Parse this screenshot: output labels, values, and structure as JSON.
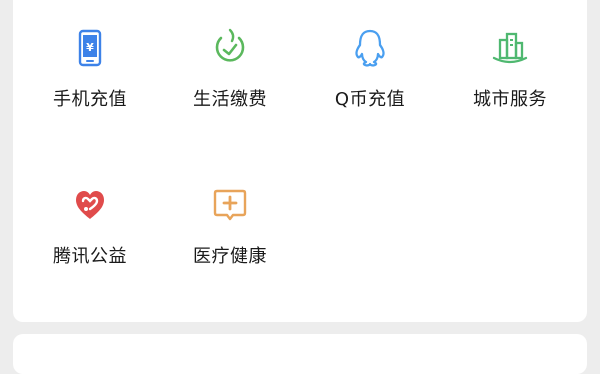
{
  "services": {
    "items": [
      {
        "label": "手机充值",
        "icon": "phone-recharge-icon",
        "color": "#3d82e8"
      },
      {
        "label": "生活缴费",
        "icon": "life-payment-icon",
        "color": "#5bb85d"
      },
      {
        "label": "Q币充值",
        "icon": "qq-penguin-icon",
        "color": "#4a9ff0"
      },
      {
        "label": "城市服务",
        "icon": "city-services-icon",
        "color": "#4fb870"
      },
      {
        "label": "腾讯公益",
        "icon": "charity-heart-icon",
        "color": "#e04b4b"
      },
      {
        "label": "医疗健康",
        "icon": "medical-health-icon",
        "color": "#e8a45a"
      }
    ]
  }
}
